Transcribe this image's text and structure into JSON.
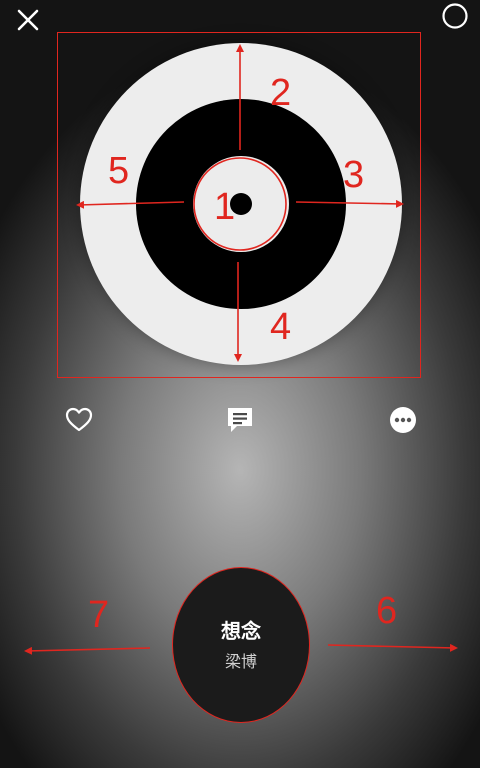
{
  "toolbar": {
    "close_icon": "close-icon",
    "right_icon": "circle-icon"
  },
  "annotations": {
    "labels": [
      "1",
      "2",
      "3",
      "4",
      "5",
      "6",
      "7"
    ],
    "color": "#e0261f"
  },
  "actions": {
    "like_icon": "heart-outline-icon",
    "comment_icon": "comment-icon",
    "more_icon": "more-icon"
  },
  "song": {
    "title": "想念",
    "artist": "梁博"
  },
  "colors": {
    "disc_outer": "#ededed",
    "disc_inner": "#000000",
    "accent_red": "#e0261f"
  }
}
